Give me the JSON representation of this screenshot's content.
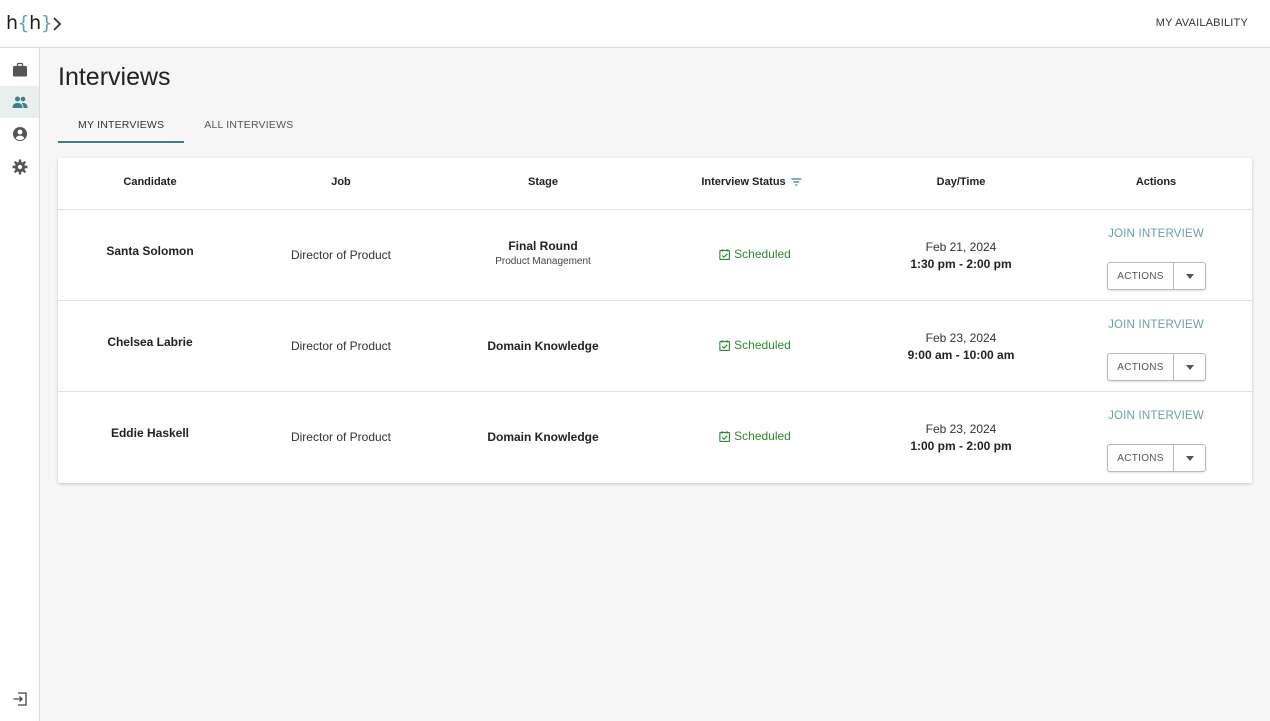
{
  "app": {
    "logo_left": "h",
    "logo_brace_open": "{",
    "logo_mid": "h",
    "logo_brace_close": "}"
  },
  "header": {
    "availability_label": "MY AVAILABILITY"
  },
  "sidebar": {
    "items": [
      {
        "icon": "briefcase-icon",
        "active": false
      },
      {
        "icon": "people-icon",
        "active": true
      },
      {
        "icon": "account-circle-icon",
        "active": false
      },
      {
        "icon": "gear-icon",
        "active": false
      }
    ],
    "bottom_icon": "logout-icon"
  },
  "page": {
    "title": "Interviews"
  },
  "tabs": [
    {
      "label": "MY INTERVIEWS",
      "active": true
    },
    {
      "label": "ALL INTERVIEWS",
      "active": false
    }
  ],
  "table": {
    "headers": {
      "candidate": "Candidate",
      "job": "Job",
      "stage": "Stage",
      "status": "Interview Status",
      "datetime": "Day/Time",
      "actions": "Actions"
    },
    "rows": [
      {
        "candidate": "Santa Solomon",
        "job": "Director of Product",
        "stage": "Final Round",
        "stage_sub": "Product Management",
        "status": "Scheduled",
        "date": "Feb 21, 2024",
        "time": "1:30 pm - 2:00 pm",
        "join_label": "JOIN INTERVIEW",
        "actions_label": "ACTIONS"
      },
      {
        "candidate": "Chelsea Labrie",
        "job": "Director of Product",
        "stage": "Domain Knowledge",
        "stage_sub": "",
        "status": "Scheduled",
        "date": "Feb 23, 2024",
        "time": "9:00 am - 10:00 am",
        "join_label": "JOIN INTERVIEW",
        "actions_label": "ACTIONS"
      },
      {
        "candidate": "Eddie Haskell",
        "job": "Director of Product",
        "stage": "Domain Knowledge",
        "stage_sub": "",
        "status": "Scheduled",
        "date": "Feb 23, 2024",
        "time": "1:00 pm - 2:00 pm",
        "join_label": "JOIN INTERVIEW",
        "actions_label": "ACTIONS"
      }
    ]
  },
  "colors": {
    "accent": "#3f7f86",
    "status_green": "#2f8a2f",
    "join_link": "#6aa0a6"
  }
}
